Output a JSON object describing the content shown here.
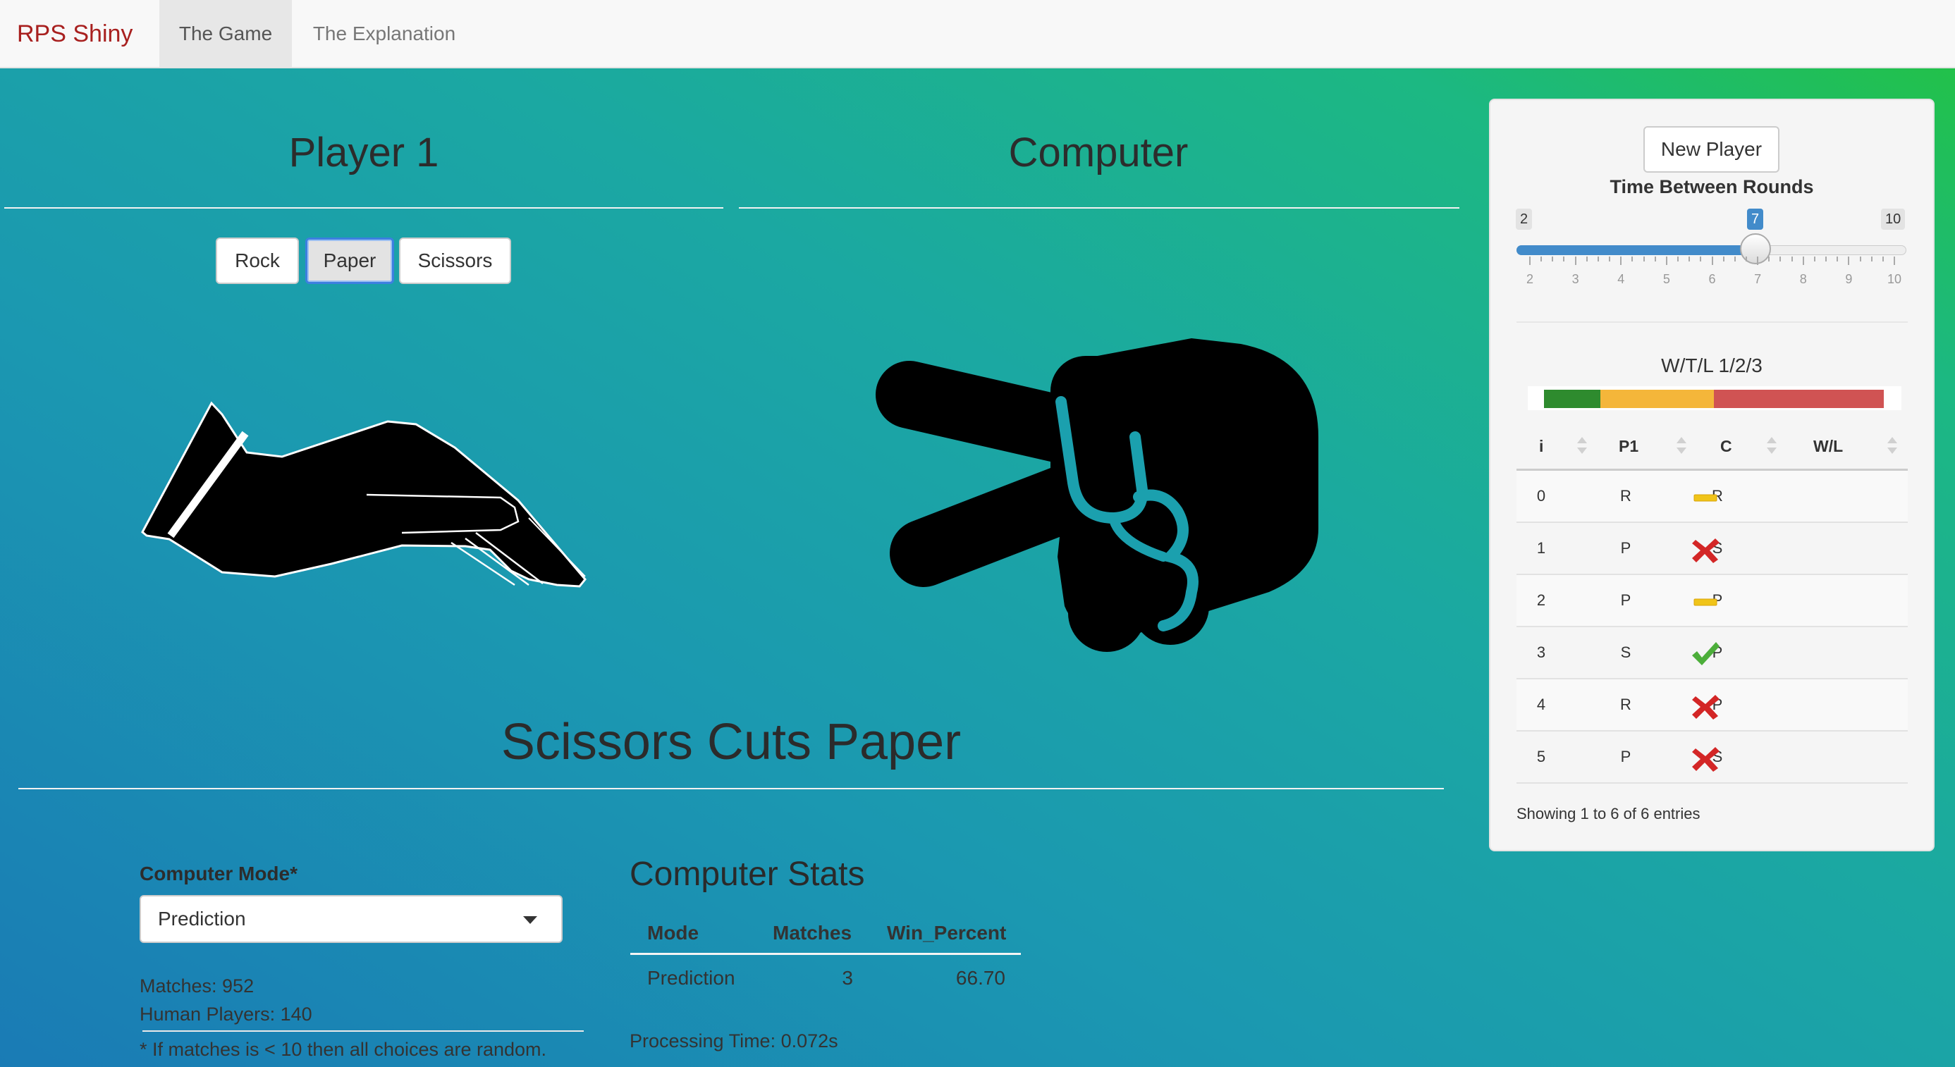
{
  "nav": {
    "brand": "RPS Shiny",
    "tabs": [
      "The Game",
      "The Explanation"
    ]
  },
  "players": {
    "player1_title": "Player 1",
    "computer_title": "Computer"
  },
  "choices": {
    "rock": "Rock",
    "paper": "Paper",
    "scissors": "Scissors",
    "selected": "Paper"
  },
  "hands": {
    "player1": "paper-hand-icon",
    "computer": "scissors-hand-icon"
  },
  "result": "Scissors Cuts Paper",
  "settings": {
    "mode_label": "Computer Mode*",
    "mode_value": "Prediction",
    "matches_text": "Matches: 952",
    "players_text": "Human Players: 140",
    "note": "* If matches is < 10 then all choices are random."
  },
  "computer_stats": {
    "title": "Computer Stats",
    "headers": [
      "Mode",
      "Matches",
      "Win_Percent"
    ],
    "row": [
      "Prediction",
      "3",
      "66.70"
    ],
    "processing": "Processing Time: 0.072s"
  },
  "panel": {
    "new_player": "New Player",
    "slider_label": "Time Between Rounds",
    "slider_min": "2",
    "slider_max": "10",
    "slider_value": "7",
    "slider_ticks": [
      "2",
      "3",
      "4",
      "5",
      "6",
      "7",
      "8",
      "9",
      "10"
    ],
    "wtl_label": "W/T/L 1/2/3",
    "wtl_fractions": {
      "win": 0.1667,
      "tie": 0.3333,
      "loss": 0.5
    },
    "colors": {
      "win": "#2e8b2e",
      "tie": "#f4b63a",
      "loss": "#d05353"
    },
    "table_headers": [
      "i",
      "P1",
      "C",
      "W/L"
    ],
    "rows": [
      {
        "i": "0",
        "p1": "R",
        "c": "R",
        "wl": "tie"
      },
      {
        "i": "1",
        "p1": "P",
        "c": "S",
        "wl": "loss"
      },
      {
        "i": "2",
        "p1": "P",
        "c": "P",
        "wl": "tie"
      },
      {
        "i": "3",
        "p1": "S",
        "c": "P",
        "wl": "win"
      },
      {
        "i": "4",
        "p1": "R",
        "c": "P",
        "wl": "loss"
      },
      {
        "i": "5",
        "p1": "P",
        "c": "S",
        "wl": "loss"
      }
    ],
    "table_info": "Showing 1 to 6 of 6 entries"
  }
}
